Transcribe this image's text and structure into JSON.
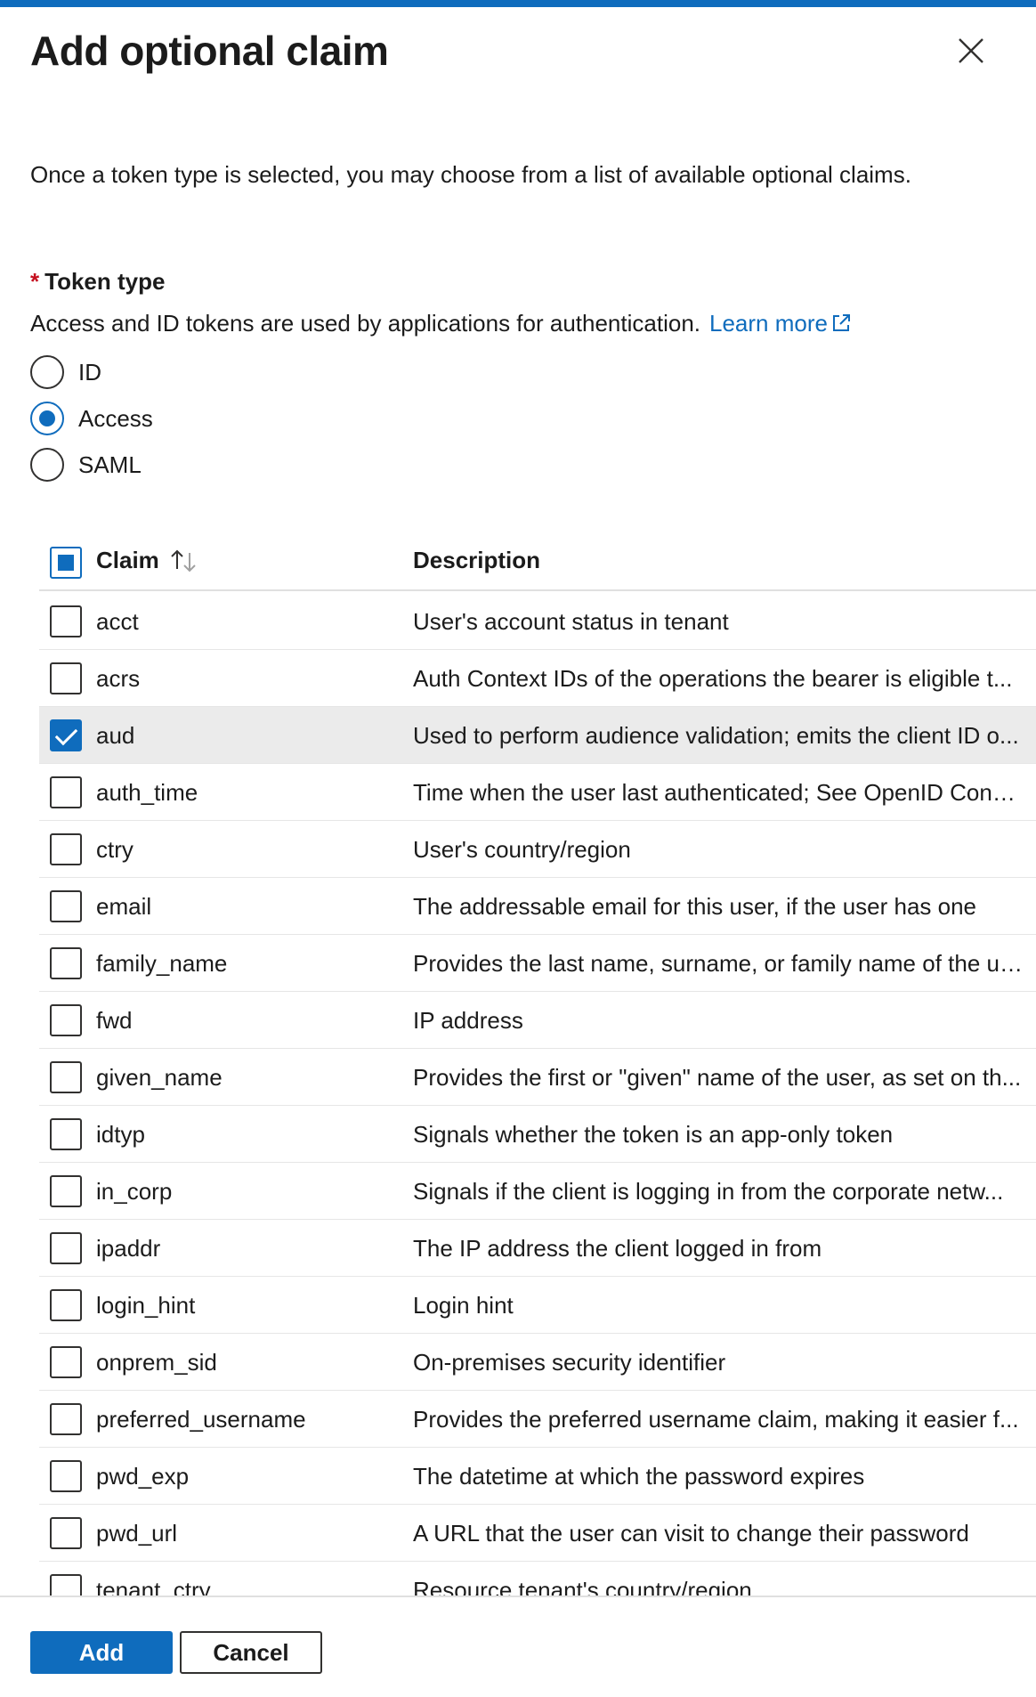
{
  "panel": {
    "title": "Add optional claim",
    "intro": "Once a token type is selected, you may choose from a list of available optional claims."
  },
  "token_type": {
    "required_marker": "*",
    "label": "Token type",
    "help": "Access and ID tokens are used by applications for authentication.",
    "learn_more": "Learn more",
    "options": [
      {
        "label": "ID",
        "checked": false
      },
      {
        "label": "Access",
        "checked": true
      },
      {
        "label": "SAML",
        "checked": false
      }
    ]
  },
  "table": {
    "columns": {
      "claim": "Claim",
      "description": "Description"
    },
    "header_checkbox_state": "indeterminate",
    "rows": [
      {
        "claim": "acct",
        "description": "User's account status in tenant",
        "checked": false
      },
      {
        "claim": "acrs",
        "description": "Auth Context IDs of the operations the bearer is eligible t...",
        "checked": false
      },
      {
        "claim": "aud",
        "description": "Used to perform audience validation; emits the client ID o...",
        "checked": true
      },
      {
        "claim": "auth_time",
        "description": "Time when the user last authenticated; See OpenID Conn...",
        "checked": false
      },
      {
        "claim": "ctry",
        "description": "User's country/region",
        "checked": false
      },
      {
        "claim": "email",
        "description": "The addressable email for this user, if the user has one",
        "checked": false
      },
      {
        "claim": "family_name",
        "description": "Provides the last name, surname, or family name of the us...",
        "checked": false
      },
      {
        "claim": "fwd",
        "description": "IP address",
        "checked": false
      },
      {
        "claim": "given_name",
        "description": "Provides the first or \"given\" name of the user, as set on th...",
        "checked": false
      },
      {
        "claim": "idtyp",
        "description": "Signals whether the token is an app-only token",
        "checked": false
      },
      {
        "claim": "in_corp",
        "description": "Signals if the client is logging in from the corporate netw...",
        "checked": false
      },
      {
        "claim": "ipaddr",
        "description": "The IP address the client logged in from",
        "checked": false
      },
      {
        "claim": "login_hint",
        "description": "Login hint",
        "checked": false
      },
      {
        "claim": "onprem_sid",
        "description": "On-premises security identifier",
        "checked": false
      },
      {
        "claim": "preferred_username",
        "description": "Provides the preferred username claim, making it easier f...",
        "checked": false
      },
      {
        "claim": "pwd_exp",
        "description": "The datetime at which the password expires",
        "checked": false
      },
      {
        "claim": "pwd_url",
        "description": "A URL that the user can visit to change their password",
        "checked": false
      },
      {
        "claim": "tenant_ctry",
        "description": "Resource tenant's country/region",
        "checked": false
      }
    ]
  },
  "footer": {
    "add_label": "Add",
    "cancel_label": "Cancel"
  },
  "colors": {
    "accent": "#0f6cbd",
    "required": "#c50f1f",
    "selected_row": "#ebebeb"
  },
  "icons": {
    "close": "close-icon",
    "external_link": "external-link-icon",
    "sort": "sort-ascending-icon"
  }
}
